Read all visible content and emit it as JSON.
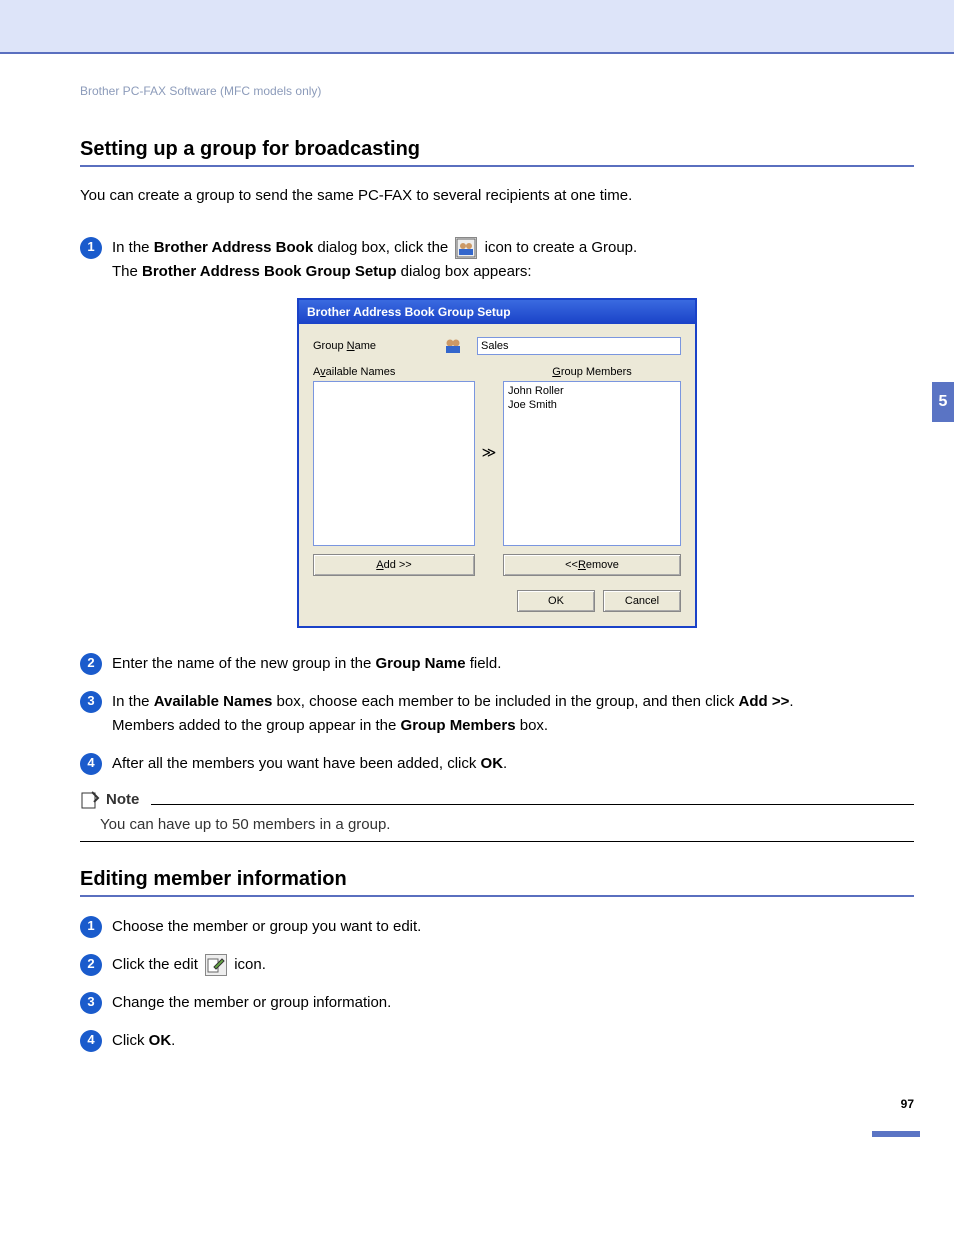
{
  "breadcrumb": "Brother PC-FAX Software (MFC models only)",
  "chapter_tab": "5",
  "section1": {
    "title": "Setting up a group for broadcasting",
    "intro": "You can create a group to send the same PC-FAX to several recipients at one time.",
    "step1_a": "In the ",
    "step1_b": "Brother Address Book",
    "step1_c": " dialog box, click the ",
    "step1_d": " icon to create a Group.",
    "step1_line2a": "The ",
    "step1_line2b": "Brother Address Book Group Setup",
    "step1_line2c": " dialog box appears:",
    "step2_a": "Enter the name of the new group in the ",
    "step2_b": "Group Name",
    "step2_c": " field.",
    "step3_a": "In the ",
    "step3_b": "Available Names",
    "step3_c": " box, choose each member to be included in the group, and then click ",
    "step3_d": "Add >>",
    "step3_e": ".",
    "step3_line2a": "Members added to the group appear in the ",
    "step3_line2b": "Group Members",
    "step3_line2c": " box.",
    "step4_a": "After all the members you want have been added, click ",
    "step4_b": "OK",
    "step4_c": "."
  },
  "dialog": {
    "title": "Brother Address Book Group Setup",
    "group_name_label": "Group Name",
    "group_name_value": "Sales",
    "available_label": "Available Names",
    "members_label": "Group Members",
    "members": [
      "John Roller",
      "Joe Smith"
    ],
    "transfer_glyph": "≫",
    "add_btn": "Add >>",
    "remove_btn": "<< Remove",
    "ok_btn": "OK",
    "cancel_btn": "Cancel"
  },
  "note": {
    "title": "Note",
    "body": "You can have up to 50 members in a group."
  },
  "section2": {
    "title": "Editing member information",
    "step1": "Choose the member or group you want to edit.",
    "step2_a": "Click the edit ",
    "step2_b": " icon.",
    "step3": "Change the member or group information.",
    "step4_a": "Click ",
    "step4_b": "OK",
    "step4_c": "."
  },
  "page_number": "97"
}
